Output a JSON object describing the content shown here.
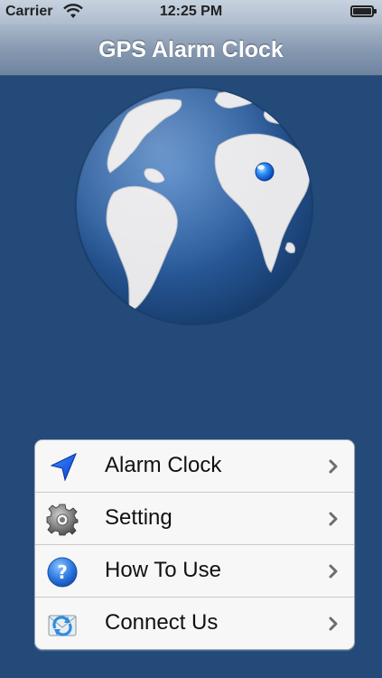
{
  "status_bar": {
    "carrier": "Carrier",
    "time": "12:25 PM",
    "wifi_icon": "wifi-icon",
    "battery_icon": "battery-icon"
  },
  "nav": {
    "title": "GPS Alarm Clock"
  },
  "globe": {
    "icon": "globe-icon",
    "marker_icon": "location-marker-icon"
  },
  "menu": {
    "items": [
      {
        "label": "Alarm Clock",
        "icon": "navigation-arrow-icon"
      },
      {
        "label": "Setting",
        "icon": "gear-icon"
      },
      {
        "label": "How To Use",
        "icon": "question-icon"
      },
      {
        "label": "Connect Us",
        "icon": "mail-sync-icon"
      }
    ],
    "chevron_icon": "chevron-right-icon"
  },
  "colors": {
    "background": "#234a78",
    "nav_bar": "#8799b1",
    "globe_ocean": "#2d5fa0",
    "marker": "#1e7bf2"
  }
}
